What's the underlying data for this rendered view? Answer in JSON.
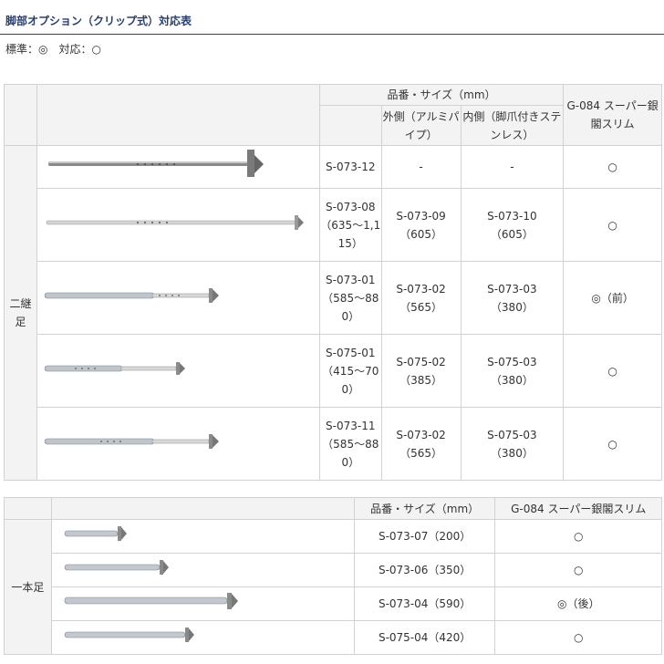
{
  "title": "脚部オプション（クリップ式）対応表",
  "legend": "標準：◎　対応：○",
  "table1": {
    "group_label": "二継足",
    "header_main": "品番・サイズ（mm）",
    "header_outer": "外側（アルミパイプ）",
    "header_inner": "内側（脚爪付きステンレス）",
    "header_compat": "G-084 スーパー銀閣スリム",
    "rows": [
      {
        "code": "S-073-12",
        "outer": "-",
        "outer_size": "",
        "inner": "-",
        "inner_size": "",
        "compat": "○"
      },
      {
        "code": "S-073-08（635～1,115）",
        "outer": "S-073-09",
        "outer_size": "（605）",
        "inner": "S-073-10",
        "inner_size": "（605）",
        "compat": "○"
      },
      {
        "code": "S-073-01（585～880）",
        "outer": "S-073-02",
        "outer_size": "（565）",
        "inner": "S-073-03",
        "inner_size": "（380）",
        "compat": "◎（前）"
      },
      {
        "code": "S-075-01（415～700）",
        "outer": "S-075-02",
        "outer_size": "（385）",
        "inner": "S-075-03",
        "inner_size": "（380）",
        "compat": "○"
      },
      {
        "code": "S-073-11（585～880）",
        "outer": "S-073-02",
        "outer_size": "（565）",
        "inner": "S-075-03",
        "inner_size": "（380）",
        "compat": "○"
      }
    ]
  },
  "table2": {
    "group_label": "一本足",
    "header_main": "品番・サイズ（mm）",
    "header_compat": "G-084 スーパー銀閣スリム",
    "rows": [
      {
        "code": "S-073-07（200）",
        "compat": "○"
      },
      {
        "code": "S-073-06（350）",
        "compat": "○"
      },
      {
        "code": "S-073-04（590）",
        "compat": "◎（後）"
      },
      {
        "code": "S-075-04（420）",
        "compat": "○"
      }
    ]
  }
}
